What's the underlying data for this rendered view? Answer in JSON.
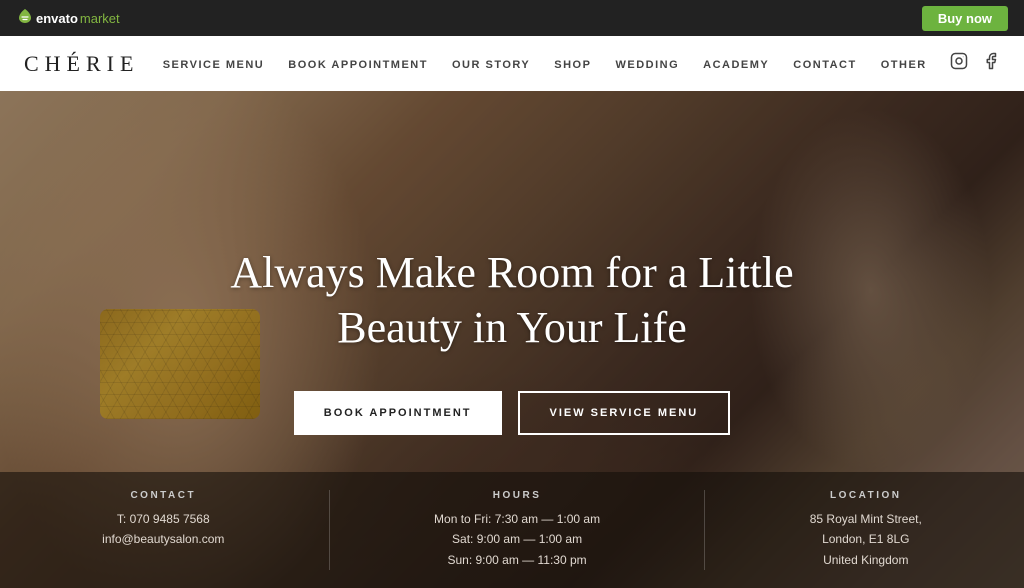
{
  "envato_bar": {
    "logo_leaf": "⬟",
    "logo_text": "envato",
    "logo_market": "market",
    "buy_now_label": "Buy now"
  },
  "nav": {
    "logo": "CHÉRIE",
    "links": [
      {
        "label": "SERVICE MENU",
        "id": "service-menu"
      },
      {
        "label": "BOOK APPOINTMENT",
        "id": "book-appointment"
      },
      {
        "label": "OUR STORY",
        "id": "our-story"
      },
      {
        "label": "SHOP",
        "id": "shop"
      },
      {
        "label": "WEDDING",
        "id": "wedding"
      },
      {
        "label": "ACADEMY",
        "id": "academy"
      },
      {
        "label": "CONTACT",
        "id": "contact"
      },
      {
        "label": "OTHER",
        "id": "other"
      }
    ],
    "social": [
      "instagram",
      "facebook"
    ]
  },
  "hero": {
    "headline_line1": "Always Make Room for a Little",
    "headline_line2": "Beauty in Your Life",
    "btn_book": "BOOK APPOINTMENT",
    "btn_view": "VIEW SERVICE MENU"
  },
  "footer_info": {
    "contact": {
      "title": "CONTACT",
      "phone": "T: 070 9485 7568",
      "email": "info@beautysalon.com"
    },
    "hours": {
      "title": "HOURS",
      "weekdays": "Mon to Fri: 7:30 am — 1:00 am",
      "saturday": "Sat: 9:00 am — 1:00 am",
      "sunday": "Sun: 9:00 am — 11:30 pm"
    },
    "location": {
      "title": "LOCATION",
      "address1": "85 Royal Mint Street,",
      "address2": "London, E1 8LG",
      "country": "United Kingdom"
    }
  }
}
